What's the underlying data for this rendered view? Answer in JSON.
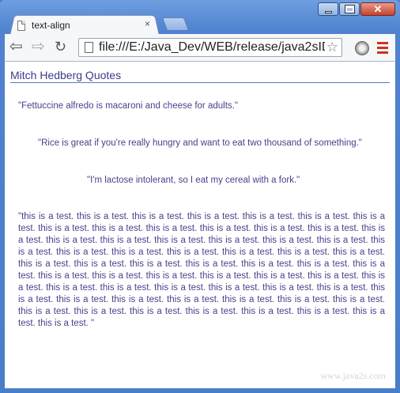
{
  "browser": {
    "tab_title": "text-align",
    "tab_close": "×",
    "url": "file:///E:/Java_Dev/WEB/release/java2sID",
    "colors": {
      "frame": "#4a7ec9",
      "menu": "#cc3322"
    }
  },
  "page": {
    "heading": "Mitch Hedberg Quotes",
    "quotes": [
      "\"Fettuccine alfredo is macaroni and cheese for adults.\"",
      "\"Rice is great if you're really hungry and want to eat two thousand of something.\"",
      "\"I'm lactose intolerant, so I eat my cereal with a fork.\""
    ],
    "test_paragraph": "\"this is a test. this is a test. this is a test. this is a test. this is a test. this is a test. this is a test. this is a test. this is a test. this is a test. this is a test. this is a test. this is a test. this is a test. this is a test. this is a test. this is a test. this is a test. this is a test. this is a test. this is a test. this is a test. this is a test. this is a test. this is a test. this is a test. this is a test. this is a test. this is a test. this is a test. this is a test. this is a test. this is a test. this is a test. this is a test. this is a test. this is a test. this is a test. this is a test. this is a test. this is a test. this is a test. this is a test. this is a test. this is a test. this is a test. this is a test. this is a test. this is a test. this is a test. this is a test. this is a test. this is a test. this is a test. this is a test. this is a test. this is a test. this is a test. this is a test. this is a test. this is a test. this is a test. \"",
    "watermark": "www.java2s.com"
  }
}
